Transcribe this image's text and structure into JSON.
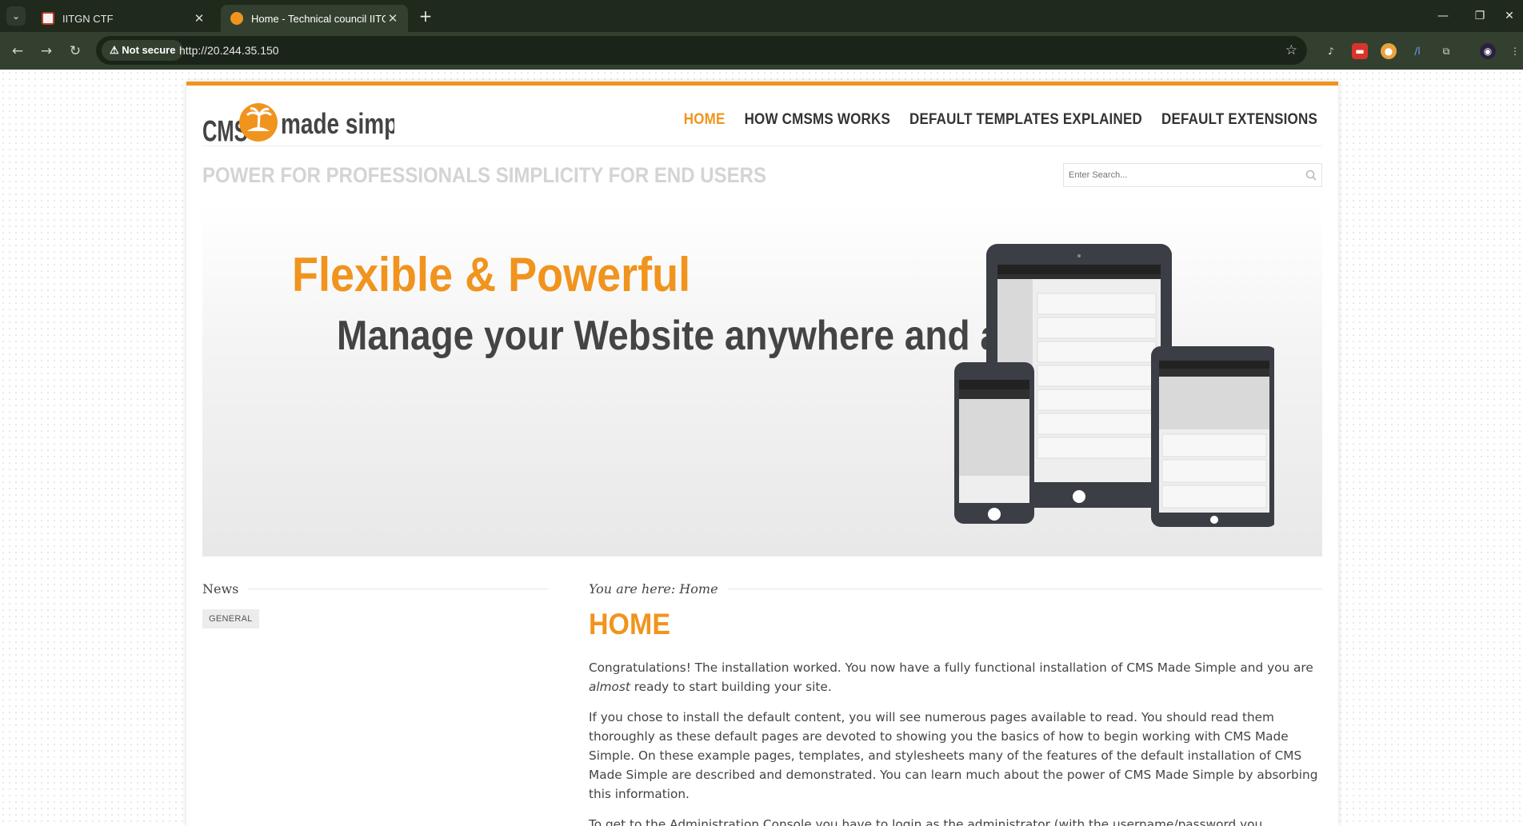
{
  "browser": {
    "tabs": [
      {
        "title": "IITGN CTF",
        "active": false
      },
      {
        "title": "Home - Technical council IITGN",
        "active": true
      }
    ],
    "security_label": "Not secure",
    "url": "http://20.244.35.150"
  },
  "site": {
    "logo_text": "CMS made simple",
    "nav": [
      "HOME",
      "HOW CMSMS WORKS",
      "DEFAULT TEMPLATES EXPLAINED",
      "DEFAULT EXTENSIONS"
    ],
    "tagline": "POWER FOR PROFESSIONALS SIMPLICITY FOR END USERS",
    "search_placeholder": "Enter Search...",
    "banner": {
      "headline": "Flexible & Powerful",
      "subheadline": "Manage your Website anywhere and anytime"
    },
    "sidebar": {
      "title": "News",
      "category": "GENERAL"
    },
    "content": {
      "breadcrumb": "You are here: Home",
      "title": "HOME",
      "p1_start": "Congratulations! The installation worked. You now have a fully functional installation of CMS Made Simple and you are ",
      "p1_em": "almost",
      "p1_end": " ready to start building your site.",
      "p2": "If you chose to install the default content, you will see numerous pages available to read. You should read them thoroughly as these default pages are devoted to showing you the basics of how to begin working with CMS Made Simple. On these example pages, templates, and stylesheets many of the features of the default installation of CMS Made Simple are described and demonstrated. You can learn much about the power of CMS Made Simple by absorbing this information.",
      "p3": "To get to the Administration Console you have to login as the administrator (with the username/password you mentioned"
    }
  },
  "colors": {
    "accent": "#f0941e",
    "text": "#444444",
    "tab_bar": "#1f2a1c",
    "toolbar": "#33402f"
  },
  "icons": [
    "tab-list-icon",
    "tab-favicon-iitgn",
    "tab-favicon-cmsms",
    "close-icon",
    "new-tab-icon",
    "minimize-icon",
    "restore-icon",
    "close-window-icon",
    "back-icon",
    "forward-icon",
    "reload-icon",
    "warning-icon",
    "bookmark-star-icon",
    "extension-icon",
    "profile-avatar-icon",
    "search-icon"
  ]
}
